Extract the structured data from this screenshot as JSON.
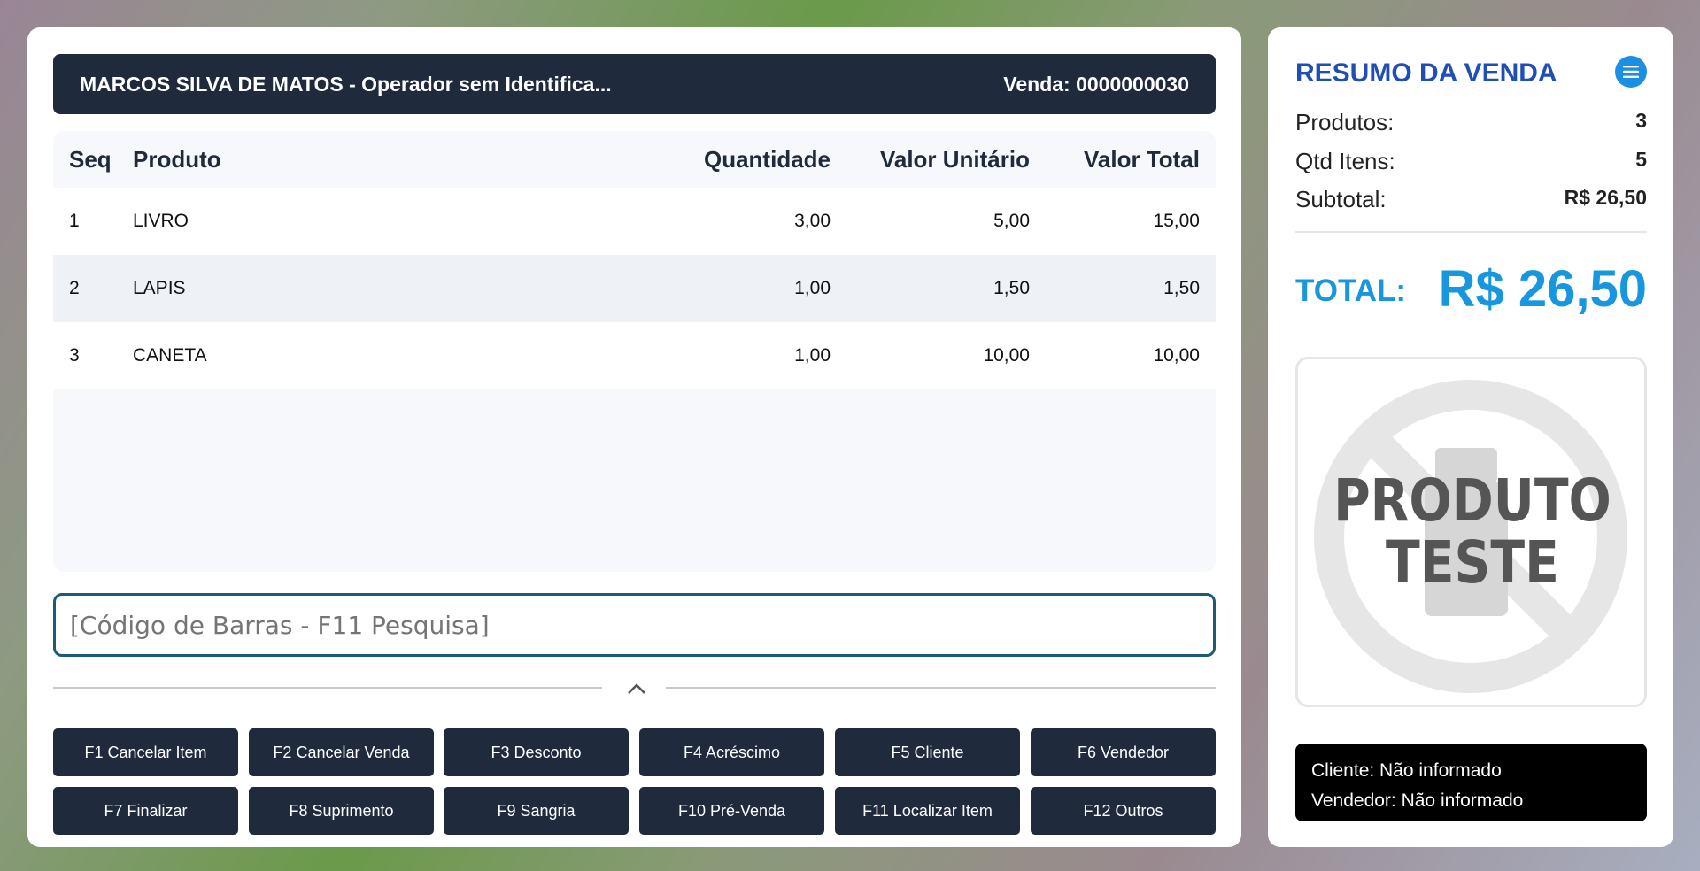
{
  "header": {
    "operator": "MARCOS SILVA DE MATOS - Operador sem Identifica...",
    "sale_label": "Venda: 0000000030"
  },
  "table": {
    "columns": [
      "Seq",
      "Produto",
      "Quantidade",
      "Valor Unitário",
      "Valor Total"
    ],
    "rows": [
      {
        "seq": "1",
        "produto": "LIVRO",
        "quantidade": "3,00",
        "valor_unitario": "5,00",
        "valor_total": "15,00"
      },
      {
        "seq": "2",
        "produto": "LAPIS",
        "quantidade": "1,00",
        "valor_unitario": "1,50",
        "valor_total": "1,50"
      },
      {
        "seq": "3",
        "produto": "CANETA",
        "quantidade": "1,00",
        "valor_unitario": "10,00",
        "valor_total": "10,00"
      }
    ]
  },
  "barcode": {
    "placeholder": "[Código de Barras - F11 Pesquisa]",
    "value": ""
  },
  "function_keys": [
    "F1 Cancelar Item",
    "F2 Cancelar Venda",
    "F3 Desconto",
    "F4 Acréscimo",
    "F5 Cliente",
    "F6 Vendedor",
    "F7 Finalizar",
    "F8 Suprimento",
    "F9 Sangria",
    "F10 Pré-Venda",
    "F11 Localizar Item",
    "F12 Outros"
  ],
  "summary": {
    "title": "RESUMO DA VENDA",
    "produtos_label": "Produtos:",
    "produtos_value": "3",
    "itens_label": "Qtd Itens:",
    "itens_value": "5",
    "subtotal_label": "Subtotal:",
    "subtotal_value": "R$ 26,50",
    "total_label": "TOTAL:",
    "total_value": "R$ 26,50"
  },
  "product_image": {
    "line1": "PRODUTO",
    "line2": "TESTE"
  },
  "info": {
    "cliente": "Cliente: Não informado",
    "vendedor": "Vendedor: Não informado"
  },
  "colors": {
    "dark": "#1f2a3d",
    "accent_blue": "#1896de",
    "title_blue": "#1f4fb4",
    "menu_blue": "#1a8fe3"
  },
  "icons": {
    "menu": "hamburger-menu-icon",
    "collapse": "chevron-up-icon"
  }
}
